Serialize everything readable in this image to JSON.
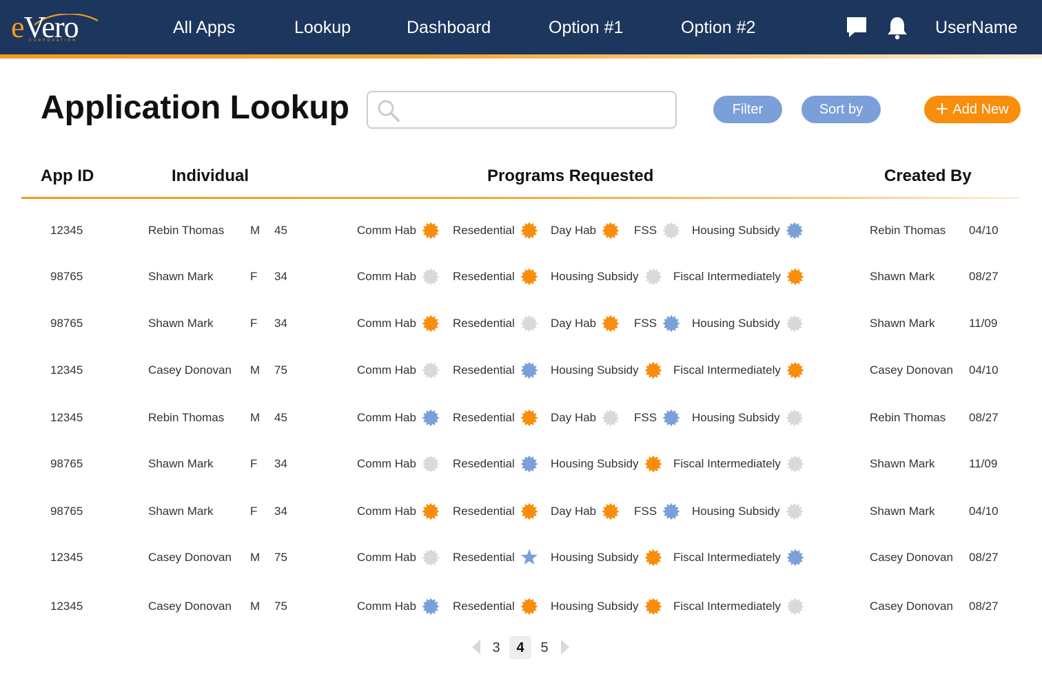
{
  "app": {
    "logo_text": "eVero",
    "logo_subtext": "CORPORATION",
    "brand_colors": {
      "navy": "#1d365d",
      "orange": "#f98d0c",
      "blue": "#7b9fd9",
      "gray": "#d9d9d9"
    }
  },
  "nav": {
    "items": [
      "All Apps",
      "Lookup",
      "Dashboard",
      "Option #1",
      "Option #2"
    ],
    "icons": [
      "chat-icon",
      "bell-icon"
    ],
    "username": "UserName"
  },
  "toolbar": {
    "title": "Application Lookup",
    "search_placeholder": "",
    "search_value": "",
    "filter_label": "Filter",
    "sort_label": "Sort by",
    "add_label": "Add New"
  },
  "table": {
    "headers": [
      "App ID",
      "Individual",
      "Programs Requested",
      "Created By"
    ],
    "status_legend": {
      "orange": "badge-orange",
      "blue": "badge-blue",
      "gray": "badge-gray",
      "star": "star-blue"
    },
    "rows": [
      {
        "app_id": "12345",
        "name": "Rebin Thomas",
        "gender": "M",
        "age": "45",
        "programs": [
          {
            "label": "Comm Hab",
            "status": "orange"
          },
          {
            "label": "Resedential",
            "status": "orange"
          },
          {
            "label": "Day Hab",
            "status": "orange"
          },
          {
            "label": "FSS",
            "status": "gray"
          },
          {
            "label": "Housing Subsidy",
            "status": "blue"
          }
        ],
        "created_by": "Rebin Thomas",
        "date": "04/10"
      },
      {
        "app_id": "98765",
        "name": "Shawn Mark",
        "gender": "F",
        "age": "34",
        "programs": [
          {
            "label": "Comm Hab",
            "status": "gray"
          },
          {
            "label": "Resedential",
            "status": "orange"
          },
          {
            "label": "Housing Subsidy",
            "status": "gray"
          },
          {
            "label": "Fiscal Intermediately",
            "status": "orange"
          }
        ],
        "created_by": "Shawn Mark",
        "date": "08/27"
      },
      {
        "app_id": "98765",
        "name": "Shawn Mark",
        "gender": "F",
        "age": "34",
        "programs": [
          {
            "label": "Comm Hab",
            "status": "orange"
          },
          {
            "label": "Resedential",
            "status": "gray"
          },
          {
            "label": "Day Hab",
            "status": "orange"
          },
          {
            "label": "FSS",
            "status": "blue"
          },
          {
            "label": "Housing Subsidy",
            "status": "gray"
          }
        ],
        "created_by": "Shawn Mark",
        "date": "11/09"
      },
      {
        "app_id": "12345",
        "name": "Casey Donovan",
        "gender": "M",
        "age": "75",
        "programs": [
          {
            "label": "Comm Hab",
            "status": "gray"
          },
          {
            "label": "Resedential",
            "status": "blue"
          },
          {
            "label": "Housing Subsidy",
            "status": "orange"
          },
          {
            "label": "Fiscal Intermediately",
            "status": "orange"
          }
        ],
        "created_by": "Casey Donovan",
        "date": "04/10"
      },
      {
        "app_id": "12345",
        "name": "Rebin Thomas",
        "gender": "M",
        "age": "45",
        "programs": [
          {
            "label": "Comm Hab",
            "status": "blue"
          },
          {
            "label": "Resedential",
            "status": "orange"
          },
          {
            "label": "Day Hab",
            "status": "gray"
          },
          {
            "label": "FSS",
            "status": "blue"
          },
          {
            "label": "Housing Subsidy",
            "status": "gray"
          }
        ],
        "created_by": "Rebin Thomas",
        "date": "08/27"
      },
      {
        "app_id": "98765",
        "name": "Shawn Mark",
        "gender": "F",
        "age": "34",
        "programs": [
          {
            "label": "Comm Hab",
            "status": "gray"
          },
          {
            "label": "Resedential",
            "status": "blue"
          },
          {
            "label": "Housing Subsidy",
            "status": "orange"
          },
          {
            "label": "Fiscal Intermediately",
            "status": "gray"
          }
        ],
        "created_by": "Shawn Mark",
        "date": "11/09"
      },
      {
        "app_id": "98765",
        "name": "Shawn Mark",
        "gender": "F",
        "age": "34",
        "programs": [
          {
            "label": "Comm Hab",
            "status": "orange"
          },
          {
            "label": "Resedential",
            "status": "orange"
          },
          {
            "label": "Day Hab",
            "status": "orange"
          },
          {
            "label": "FSS",
            "status": "blue"
          },
          {
            "label": "Housing Subsidy",
            "status": "gray"
          }
        ],
        "created_by": "Shawn Mark",
        "date": "04/10"
      },
      {
        "app_id": "12345",
        "name": "Casey Donovan",
        "gender": "M",
        "age": "75",
        "programs": [
          {
            "label": "Comm Hab",
            "status": "gray"
          },
          {
            "label": "Resedential",
            "status": "star"
          },
          {
            "label": "Housing Subsidy",
            "status": "orange"
          },
          {
            "label": "Fiscal Intermediately",
            "status": "blue"
          }
        ],
        "created_by": "Casey Donovan",
        "date": "08/27"
      },
      {
        "app_id": "12345",
        "name": "Casey Donovan",
        "gender": "M",
        "age": "75",
        "programs": [
          {
            "label": "Comm Hab",
            "status": "blue"
          },
          {
            "label": "Resedential",
            "status": "orange"
          },
          {
            "label": "Housing Subsidy",
            "status": "orange"
          },
          {
            "label": "Fiscal Intermediately",
            "status": "gray"
          }
        ],
        "created_by": "Casey Donovan",
        "date": "08/27"
      }
    ]
  },
  "pagination": {
    "pages": [
      "3",
      "4",
      "5"
    ],
    "current": "4",
    "icons": [
      "chevron-left-icon",
      "chevron-right-icon"
    ]
  }
}
